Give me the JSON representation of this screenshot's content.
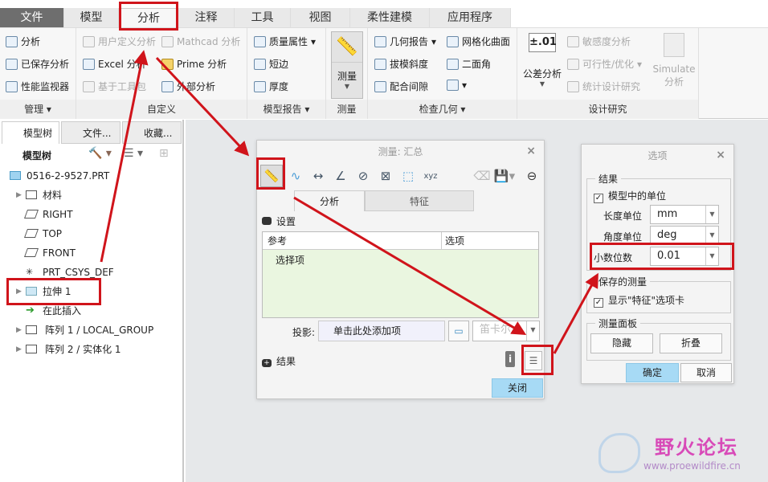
{
  "tabs": [
    "文件",
    "模型",
    "分析",
    "注释",
    "工具",
    "视图",
    "柔性建模",
    "应用程序"
  ],
  "ribbon": {
    "manage": {
      "items": [
        "分析",
        "已保存分析",
        "性能监视器"
      ],
      "label": "管理"
    },
    "custom": {
      "items": [
        "用户定义分析",
        "Mathcad 分析",
        "Excel 分析",
        "Prime 分析",
        "基于工具包",
        "外部分析"
      ],
      "label": "自定义"
    },
    "model_report": {
      "items": [
        "质量属性",
        "短边",
        "厚度"
      ],
      "label": "模型报告"
    },
    "measure": {
      "button": "测量",
      "label": "测量"
    },
    "inspect": {
      "items": [
        "几何报告",
        "网格化曲面",
        "拔模斜度",
        "二面角",
        "配合间隙"
      ],
      "label": "检查几何"
    },
    "design": {
      "tolerance_icon": "±.01",
      "tolerance": "公差分析",
      "items": [
        "敏感度分析",
        "可行性/优化",
        "统计设计研究"
      ],
      "simulate": "Simulate",
      "simulate2": "分析",
      "label": "设计研究"
    }
  },
  "left": {
    "tabs": [
      "模型树",
      "文件...",
      "收藏..."
    ],
    "header": "模型树",
    "tree": [
      "0516-2-9527.PRT",
      "材料",
      "RIGHT",
      "TOP",
      "FRONT",
      "PRT_CSYS_DEF",
      "拉伸 1",
      "在此插入",
      "阵列 1 / LOCAL_GROUP",
      "阵列 2 / 实体化 1"
    ]
  },
  "measure_dlg": {
    "title": "测量: 汇总",
    "tabs": [
      "分析",
      "特征"
    ],
    "settings": "设置",
    "col_ref": "参考",
    "col_opt": "选项",
    "select_item": "选择项",
    "projection_label": "投影:",
    "projection_value": "单击此处添加项",
    "coord": "笛卡尔",
    "results": "结果",
    "close": "关闭"
  },
  "options_dlg": {
    "title": "选项",
    "results": "结果",
    "units_in_model": "模型中的单位",
    "length_label": "长度单位",
    "length_value": "mm",
    "angle_label": "角度单位",
    "angle_value": "deg",
    "decimals_label": "小数位数",
    "decimals_value": "0.01",
    "saved": "保存的测量",
    "show_feature_tab": "显示\"特征\"选项卡",
    "panel": "测量面板",
    "hide": "隐藏",
    "collapse": "折叠",
    "ok": "确定",
    "cancel": "取消"
  },
  "watermark": {
    "name": "野火论坛",
    "url": "www.proewildfire.cn"
  },
  "colors": {
    "annotation": "#d0141b",
    "accent": "#a7daf5",
    "selection_bg": "#eaf6e0"
  }
}
